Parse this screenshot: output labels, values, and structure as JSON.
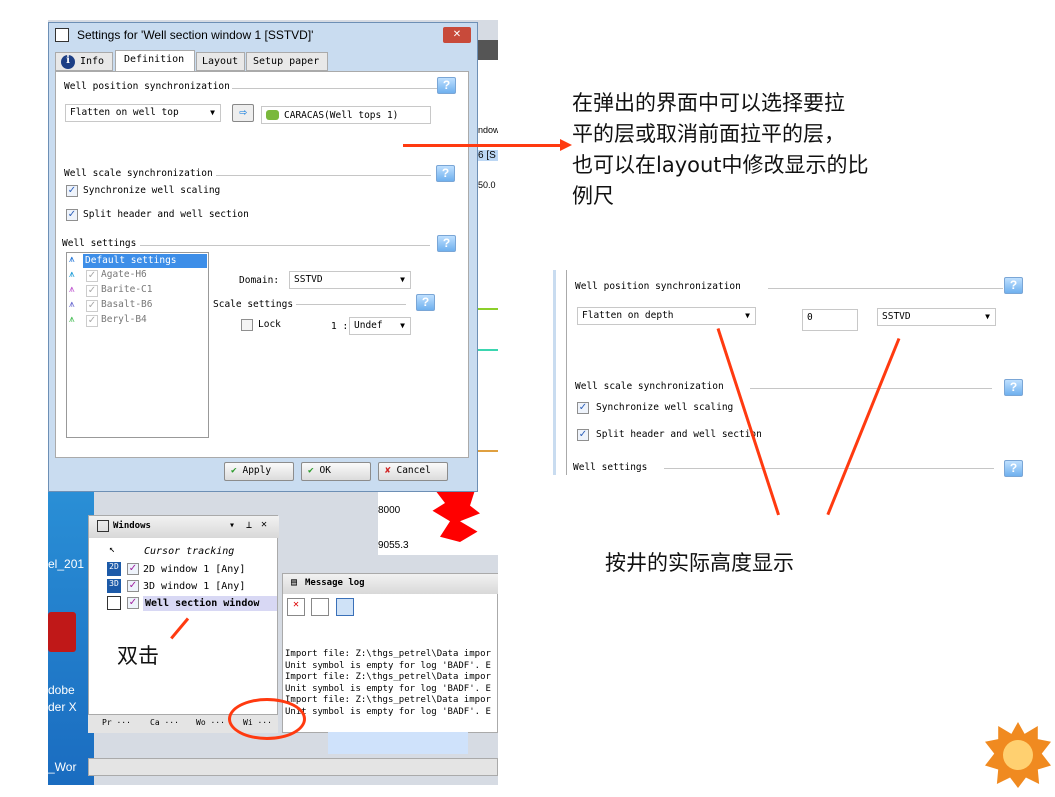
{
  "dialog": {
    "title": "Settings for 'Well section window 1 [SSTVD]'",
    "close": "✕",
    "tabs": [
      {
        "label": "Info"
      },
      {
        "label": "Definition"
      },
      {
        "label": "Layout"
      },
      {
        "label": "Setup paper"
      }
    ],
    "position_sync": {
      "heading": "Well position synchronization",
      "mode": "Flatten on well top",
      "surface": "CARACAS(Well tops 1)"
    },
    "scale_sync": {
      "heading": "Well scale synchronization",
      "sync_label": "Synchronize well scaling",
      "sync_checked": true,
      "split_label": "Split header and well section",
      "split_checked": true
    },
    "well_settings": {
      "heading": "Well settings",
      "items": [
        {
          "label": "Default settings",
          "selected": true,
          "color": "#1e73d8"
        },
        {
          "label": "Agate-H6",
          "checked": true,
          "color": "#1a9ad6"
        },
        {
          "label": "Barite-C1",
          "checked": true,
          "color": "#c05ad0"
        },
        {
          "label": "Basalt-B6",
          "checked": true,
          "color": "#6a6ad0"
        },
        {
          "label": "Beryl-B4",
          "checked": true,
          "color": "#4cbf5a"
        }
      ],
      "domain_label": "Domain:",
      "domain_value": "SSTVD",
      "scale_heading": "Scale settings",
      "lock_label": "Lock",
      "lock_checked": false,
      "ratio_prefix": "1 :",
      "ratio_value": "Undef"
    },
    "buttons": {
      "apply": "Apply",
      "ok": "OK",
      "cancel": "Cancel"
    }
  },
  "background_app": {
    "depth_label_1": "8000",
    "depth_label_2": "9055.3",
    "partial_1": "ndow",
    "partial_2": "6 [S",
    "partial_3": "50.0",
    "windows_panel": {
      "title": "Windows",
      "items": [
        {
          "label": "Cursor tracking"
        },
        {
          "label": "2D window 1 [Any]",
          "icon": "2D",
          "checked": true
        },
        {
          "label": "3D window 1 [Any]",
          "icon": "3D",
          "checked": true
        },
        {
          "label": "Well section window",
          "checked": true,
          "selected": true
        }
      ],
      "tabs": [
        "Pr ···",
        "Ca ···",
        "Wo ···",
        "Wi ···"
      ]
    },
    "message_log": {
      "title": "Message log",
      "lines": [
        "Import file: Z:\\thgs_petrel\\Data impor",
        "Unit symbol is empty for log 'BADF'. E",
        "Import file: Z:\\thgs_petrel\\Data impor",
        "Unit symbol is empty for log 'BADF'. E",
        "Import file: Z:\\thgs_petrel\\Data impor",
        "Unit symbol is empty for log 'BADF'. E"
      ]
    },
    "desktop": {
      "icon1": "el_201",
      "icon2_line1": "dobe",
      "icon2_line2": "der X",
      "icon3": "_Wor"
    }
  },
  "annotations": {
    "top": [
      "在弹出的界面中可以选择要拉",
      "平的层或取消前面拉平的层，",
      "也可以在layout中修改显示的比",
      "例尺"
    ],
    "double_click": "双击",
    "actual_height": "按井的实际高度显示",
    "arrow_color": "#ff3a10"
  },
  "inset": {
    "position_heading": "Well position synchronization",
    "mode": "Flatten on depth",
    "depth_value": "0",
    "domain": "SSTVD",
    "scale_heading": "Well scale synchronization",
    "sync_label": "Synchronize well scaling",
    "split_label": "Split header and well section",
    "well_settings": "Well settings"
  }
}
